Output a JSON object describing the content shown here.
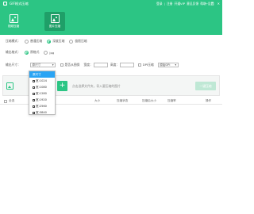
{
  "app": {
    "title": "GIF格式压缩"
  },
  "topnav": [
    "登录",
    "注册",
    "开通VIP",
    "意见反馈",
    "帮助",
    "设置"
  ],
  "window_buttons": [
    "—",
    "□",
    "✕"
  ],
  "mode_tabs": [
    {
      "label": "视频压缩",
      "icon": "video-icon",
      "active": false
    },
    {
      "label": "图片压缩",
      "icon": "image-icon",
      "active": true
    }
  ],
  "settings": {
    "compress_mode": {
      "label": "压缩模式：",
      "options": [
        "普通压缩",
        "深度压缩",
        "极限压缩"
      ],
      "selected": "深度压缩"
    },
    "output_format": {
      "label": "输出格式：",
      "options": [
        "原格式",
        "jpg"
      ],
      "selected": "原格式"
    },
    "output_size": {
      "label": "输出尺寸：",
      "value": "原尺寸",
      "keep_ratio_label": "是否从图保",
      "width_label": "宽度：",
      "height_label": "高度：",
      "dpi_label": "DPI压缩",
      "dpi_value": "原始DPI"
    }
  },
  "size_dropdown": {
    "items": [
      "原尺寸",
      "宽:1024",
      "宽:1080",
      "宽:1280",
      "宽:1920",
      "宽:2560",
      "宽:3840"
    ],
    "selected_index": 0
  },
  "dropbar": {
    "hint": "点击选择文件夹，导入要压缩的图片",
    "compress_button": "一键压缩",
    "add_button": "+"
  },
  "table": {
    "columns": [
      "全选",
      "大小",
      "压缩状态",
      "压缩后大小",
      "压缩率",
      "操作"
    ]
  },
  "colors": {
    "brand": "#2cc584",
    "brand_dark": "#1f9f68",
    "selection": "#2aa4f4"
  }
}
